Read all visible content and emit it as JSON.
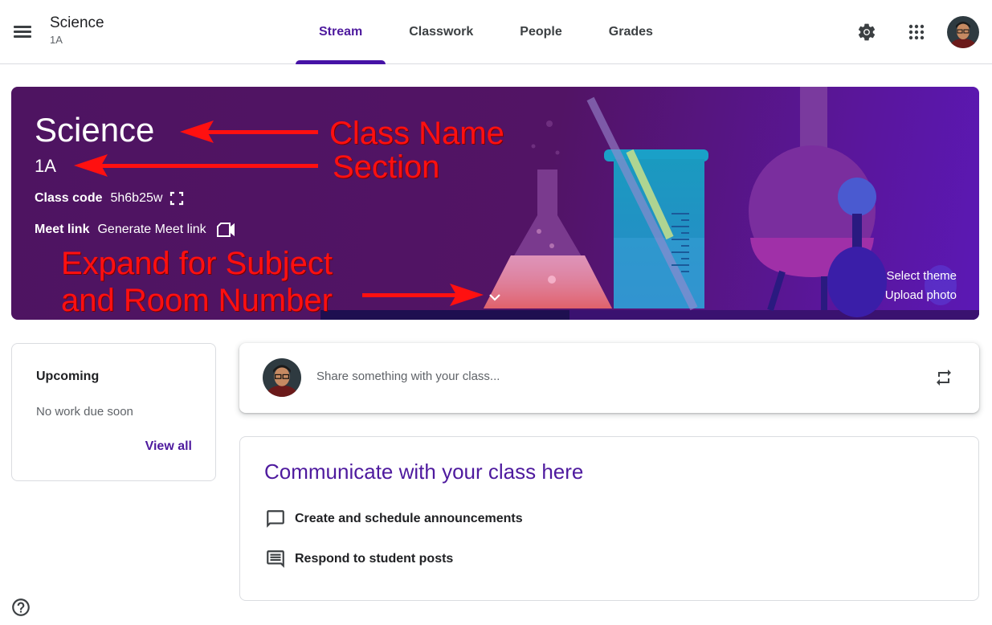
{
  "header": {
    "class_name": "Science",
    "section": "1A",
    "tabs": [
      {
        "label": "Stream",
        "active": true
      },
      {
        "label": "Classwork",
        "active": false
      },
      {
        "label": "People",
        "active": false
      },
      {
        "label": "Grades",
        "active": false
      }
    ],
    "icons": [
      "menu-icon",
      "gear-icon",
      "apps-grid-icon",
      "avatar"
    ]
  },
  "banner": {
    "class_name": "Science",
    "section": "1A",
    "class_code_label": "Class code",
    "class_code": "5h6b25w",
    "meet_link_label": "Meet link",
    "meet_link_action": "Generate Meet link",
    "select_theme": "Select theme",
    "upload_photo": "Upload photo",
    "theme_colors": {
      "background": "#521465",
      "accent": "#5b18b5"
    }
  },
  "annotations": {
    "class_name": "Class Name",
    "section": "Section",
    "expand_line1": "Expand for Subject",
    "expand_line2": "and Room Number",
    "color": "#ff1010"
  },
  "upcoming": {
    "title": "Upcoming",
    "empty_text": "No work due soon",
    "view_all": "View all"
  },
  "share": {
    "placeholder": "Share something with your class..."
  },
  "communicate": {
    "title": "Communicate with your class here",
    "items": [
      {
        "icon": "announcement-icon",
        "label": "Create and schedule announcements"
      },
      {
        "icon": "student-posts-icon",
        "label": "Respond to student posts"
      }
    ]
  },
  "colors": {
    "accent": "#4e1a9e",
    "text": "#3c4043",
    "border": "#dadce0"
  }
}
